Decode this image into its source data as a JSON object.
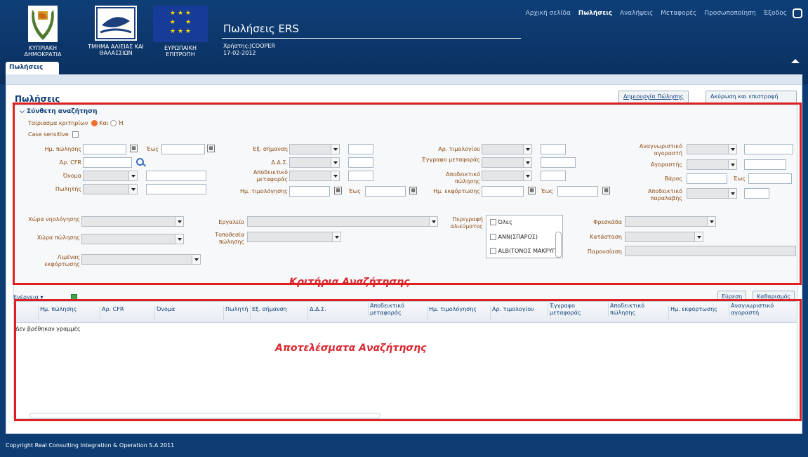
{
  "header": {
    "app_title": "Πωλήσεις ERS",
    "user": "Χρήστης:JCOOPER",
    "date": "17-02-2012",
    "logos": [
      {
        "label": "ΚΥΠΡΙΑΚΗ ΔΗΜΟΚΡΑΤΙΑ"
      },
      {
        "label": "ΤΜΗΜΑ ΑΛΙΕΙΑΣ ΚΑΙ ΘΑΛΑΣΣΙΩΝ"
      },
      {
        "label": "ΕΥΡΩΠΑΙΚΗ ΕΠΙΤΡΟΠΗ"
      }
    ],
    "nav": [
      "Αρχική σελίδα",
      "Πωλήσεις",
      "Αναλήψεις",
      "Μεταφορές",
      "Προσωποποίηση",
      "Έξοδος"
    ],
    "active_nav": "Πωλήσεις",
    "tab": "Πωλήσεις"
  },
  "panel": {
    "title": "Πωλήσεις",
    "create_button": "Δημιουργία Πώλησης",
    "cancel_button": "Ακύρωση και επιστροφή"
  },
  "search": {
    "title": "Σύνθετη αναζήτηση",
    "match_label": "Ταίριασμα κριτηρίων",
    "match_and": "Και",
    "match_or": "Ή",
    "match_selected": "Και",
    "case_sensitive": "Case sensitive",
    "labels": {
      "sale_date": "Ημ. πώλησης",
      "to": "Έως",
      "cfr": "Αρ. CFR",
      "name": "Όνομα",
      "seller": "Πωλητής",
      "ext_mark": "Εξ. σήμανση",
      "dds": "Δ.Δ.Σ.",
      "transport_proof": "Αποδεικτικό μεταφοράς",
      "invoice_date": "Ημ. τιμολόγησης",
      "invoice_no": "Αρ. τιμολογίου",
      "transport_doc": "Έγγραφο μεταφοράς",
      "sale_proof": "Αποδεικτικό πώλησης",
      "unload_date": "Ημ. εκφόρτωσης",
      "buyer_id": "Αναγνωριστικό αγοραστή",
      "buyer": "Αγοραστής",
      "weight": "Βάρος",
      "receipt_proof": "Αποδεικτικό παραλαβής",
      "billing_country": "Χώρα νηολόγησης",
      "sale_country": "Χώρα πώλησης",
      "unload_port": "Λιμένας εκφόρτωσης",
      "gear": "Εργαλείο",
      "sale_location": "Τοποθεσία πώλησης",
      "species": "Περιγραφή αλιεύματος",
      "freshness": "Φρεσκάδα",
      "status": "Κατάσταση",
      "presentation": "Παρουσίαση"
    },
    "species_options": [
      "Όλες",
      "ANN(ΣΠΑΡΟΣ)",
      "ALB(ΤΟΝΟΣ ΜΑΚΡΥΠ"
    ],
    "criteria_caption": "Κριτήρια Αναζήτησης",
    "find_button": "Εύρεση",
    "clear_button": "Καθαρισμός"
  },
  "results": {
    "actions_menu": "Ενέργεια ▾",
    "columns": [
      "Ημ. πώλησης",
      "Αρ. CFR",
      "Όνομα",
      "Πωλητής",
      "Εξ. σήμανση",
      "Δ.Δ.Σ.",
      "Αποδεικτικό μεταφοράς",
      "Ημ. τιμολόγησης",
      "Αρ. τιμολογίου",
      "Έγγραφο μεταφοράς",
      "Αποδεικτικό πώλησης",
      "Ημ. εκφόρτωσης",
      "Αναγνωριστικό αγοραστή"
    ],
    "empty_message": "Δεν βρέθηκαν γραμμές",
    "results_caption": "Αποτελέσματα Αναζήτησης"
  },
  "footer": {
    "copyright": "Copyright Real Consulting Integration & Operation S.A 2011"
  },
  "colors": {
    "brand": "#0d3d73",
    "label": "#8a4a10",
    "highlight": "#e02020",
    "accent_radio": "#f36d2a"
  }
}
